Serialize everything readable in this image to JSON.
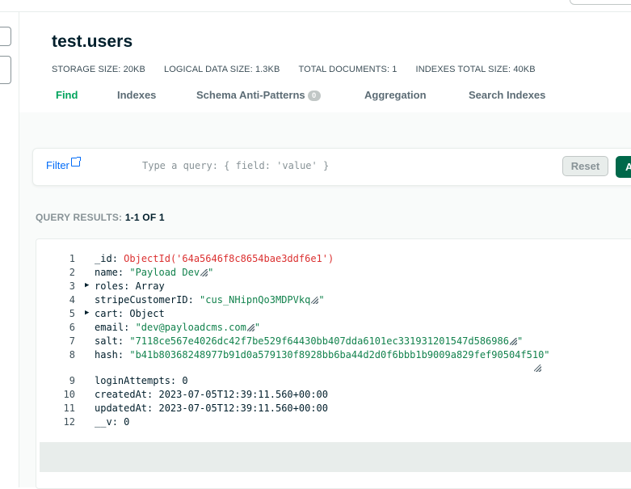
{
  "namespace": {
    "title": "test.users"
  },
  "stats": [
    {
      "label": "STORAGE SIZE:",
      "value": "20KB"
    },
    {
      "label": "LOGICAL DATA SIZE:",
      "value": "1.3KB"
    },
    {
      "label": "TOTAL DOCUMENTS:",
      "value": "1"
    },
    {
      "label": "INDEXES TOTAL SIZE:",
      "value": "40KB"
    }
  ],
  "tabs": [
    {
      "label": "Find",
      "active": true
    },
    {
      "label": "Indexes"
    },
    {
      "label": "Schema Anti-Patterns",
      "badge": "0"
    },
    {
      "label": "Aggregation"
    },
    {
      "label": "Search Indexes"
    }
  ],
  "query": {
    "filter_label": "Filter",
    "placeholder": "Type a query: { field: 'value' }",
    "reset_label": "Reset",
    "apply_label": "A"
  },
  "results": {
    "label": "QUERY RESULTS:",
    "count": "1-1 OF 1"
  },
  "document": {
    "lines": [
      {
        "num": "1",
        "key": "_id",
        "value": "ObjectId('64a5646f8c8654bae3ddf6e1')"
      },
      {
        "num": "2",
        "key": "name",
        "value": "\"Payload Dev",
        "tail": "\""
      },
      {
        "num": "3",
        "key": "roles",
        "value": "Array"
      },
      {
        "num": "4",
        "key": "stripeCustomerID",
        "value": "\"cus_NHipnQo3MDPVkq",
        "tail": "\""
      },
      {
        "num": "5",
        "key": "cart",
        "value": "Object"
      },
      {
        "num": "6",
        "key": "email",
        "value": "\"dev@payloadcms.com",
        "tail": "\""
      },
      {
        "num": "7",
        "key": "salt",
        "value": "\"7118ce567e4026dc42f7be529f64430bb407dda6101ec331931201547d586986",
        "tail": "\""
      },
      {
        "num": "8",
        "key": "hash",
        "value": "\"b41b80368248977b91d0a579130f8928bb6ba44d2d0f6bbb1b9009a829fef90504f510\""
      },
      {
        "num": "9",
        "key": "loginAttempts",
        "value": "0"
      },
      {
        "num": "10",
        "key": "createdAt",
        "value": "2023-07-05T12:39:11.560+00:00"
      },
      {
        "num": "11",
        "key": "updatedAt",
        "value": "2023-07-05T12:39:11.560+00:00"
      },
      {
        "num": "12",
        "key": "__v",
        "value": "0"
      }
    ]
  },
  "colors": {
    "accent_green": "#00a35c",
    "link_blue": "#016bf8",
    "objectid_red": "#db3030",
    "string_green": "#12824d",
    "apply_button": "#00684a"
  }
}
